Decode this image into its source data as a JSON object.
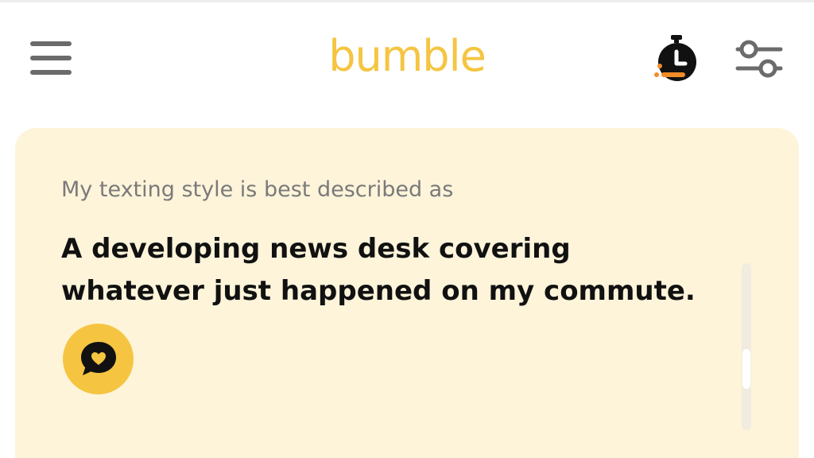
{
  "app": {
    "logo_text": "bumble",
    "brand_color": "#f5c542",
    "card_background": "#fdf4da"
  },
  "header": {
    "menu_icon": "hamburger-menu-icon",
    "timer_icon": "stopwatch-icon",
    "timer_accent_color": "#f28c28",
    "filter_icon": "sliders-filter-icon"
  },
  "prompt_card": {
    "prompt": "My texting style is best described as",
    "answer": "A developing news desk covering whatever just happened on my commute.",
    "comment_icon": "heart-speech-bubble-icon"
  }
}
